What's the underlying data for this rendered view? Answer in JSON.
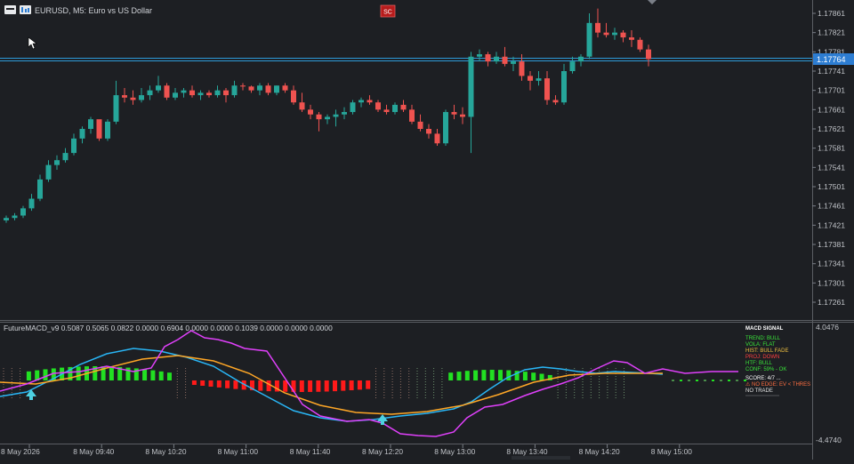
{
  "header": {
    "symbol_title": "EURUSD, M5:  Euro vs US Dollar",
    "mode_badge": "SC"
  },
  "price_axis": {
    "labels": [
      "1.17861",
      "1.17821",
      "1.17781",
      "1.17741",
      "1.17701",
      "1.17661",
      "1.17621",
      "1.17581",
      "1.17541",
      "1.17501",
      "1.17461",
      "1.17421",
      "1.17381",
      "1.17341",
      "1.17301",
      "1.17261"
    ],
    "current_price": "1.17764"
  },
  "indicator": {
    "title": "FutureMACD_v9 0.5087 0.5065 0.0822 0.0000 0.6904 0.0000 0.0000 0.1039 0.0000 0.0000 0.0000",
    "scale_top": "4.0476",
    "scale_bottom": "-4.4740",
    "signal_panel": {
      "title": "MACD SIGNAL",
      "lines": [
        {
          "text": "TREND:  BULL",
          "color": "#39e339"
        },
        {
          "text": "VOLA:  FLAT",
          "color": "#39e339"
        },
        {
          "text": "HIST:  BULL FADE",
          "color": "#f0c040"
        },
        {
          "text": "PROJ:  DOWN",
          "color": "#ff4040"
        },
        {
          "text": "HTF:  BULL",
          "color": "#39e339"
        },
        {
          "text": "CONF:  59% - OK",
          "color": "#39e339"
        }
      ],
      "score": "SCORE: 4/7 ...",
      "warning": "⚠ NO EDGE: EV < THRES",
      "verdict": "NO TRADE"
    }
  },
  "time_axis": {
    "labels": [
      "8 May 2026",
      "8 May 09:40",
      "8 May 10:20",
      "8 May 11:00",
      "8 May 11:40",
      "8 May 12:20",
      "8 May 13:00",
      "8 May 13:40",
      "8 May 14:20",
      "8 May 15:00"
    ]
  },
  "colors": {
    "background": "#1d1f23",
    "bull_candle": "#26a69a",
    "bear_candle": "#ef5350",
    "hist_positive": "#22e022",
    "hist_negative": "#ff1a1a",
    "macd_line": "#29b6f6",
    "signal_line": "#ffa726",
    "projection_line": "#e040fb",
    "price_line": "#2d9cdb"
  },
  "chart_data": {
    "type": "candlestick",
    "x_start": "8 May 2026 09:10",
    "timeframe": "M5",
    "ylim": [
      1.17241,
      1.17891
    ],
    "candles": [
      [
        1.17431,
        1.17441,
        1.17426,
        1.17436
      ],
      [
        1.17436,
        1.17446,
        1.17431,
        1.17441
      ],
      [
        1.17441,
        1.17461,
        1.17436,
        1.17456
      ],
      [
        1.17456,
        1.17486,
        1.17451,
        1.17476
      ],
      [
        1.17476,
        1.17526,
        1.17471,
        1.17516
      ],
      [
        1.17516,
        1.17556,
        1.17511,
        1.17546
      ],
      [
        1.17546,
        1.17566,
        1.17536,
        1.17556
      ],
      [
        1.17556,
        1.17581,
        1.17551,
        1.17571
      ],
      [
        1.17571,
        1.17611,
        1.17566,
        1.17601
      ],
      [
        1.17601,
        1.17626,
        1.17591,
        1.17621
      ],
      [
        1.17621,
        1.17646,
        1.17611,
        1.17641
      ],
      [
        1.17641,
        1.17631,
        1.17596,
        1.17601
      ],
      [
        1.17601,
        1.17641,
        1.17596,
        1.17636
      ],
      [
        1.17636,
        1.17721,
        1.17631,
        1.17691
      ],
      [
        1.17691,
        1.17706,
        1.17676,
        1.17686
      ],
      [
        1.17686,
        1.17701,
        1.17671,
        1.17681
      ],
      [
        1.17681,
        1.17706,
        1.17676,
        1.17691
      ],
      [
        1.17691,
        1.17711,
        1.17681,
        1.17701
      ],
      [
        1.17701,
        1.17731,
        1.17696,
        1.17711
      ],
      [
        1.17711,
        1.17716,
        1.17681,
        1.17686
      ],
      [
        1.17686,
        1.17706,
        1.17681,
        1.17696
      ],
      [
        1.17696,
        1.17706,
        1.17686,
        1.17701
      ],
      [
        1.17701,
        1.17711,
        1.17686,
        1.17691
      ],
      [
        1.17691,
        1.17701,
        1.17681,
        1.17696
      ],
      [
        1.17696,
        1.17701,
        1.17686,
        1.17691
      ],
      [
        1.17691,
        1.17711,
        1.17686,
        1.17701
      ],
      [
        1.17701,
        1.17706,
        1.17676,
        1.17691
      ],
      [
        1.17691,
        1.17721,
        1.17686,
        1.17711
      ],
      [
        1.17711,
        1.17716,
        1.17701,
        1.17709
      ],
      [
        1.17709,
        1.17711,
        1.17696,
        1.17701
      ],
      [
        1.17701,
        1.17716,
        1.17691,
        1.17711
      ],
      [
        1.17711,
        1.17716,
        1.17691,
        1.17696
      ],
      [
        1.17696,
        1.17711,
        1.17691,
        1.17711
      ],
      [
        1.17711,
        1.17716,
        1.17696,
        1.17701
      ],
      [
        1.17701,
        1.17711,
        1.17671,
        1.17676
      ],
      [
        1.17676,
        1.17696,
        1.17656,
        1.17661
      ],
      [
        1.17661,
        1.17671,
        1.17641,
        1.17651
      ],
      [
        1.17651,
        1.17656,
        1.17616,
        1.17641
      ],
      [
        1.17641,
        1.17651,
        1.17631,
        1.17646
      ],
      [
        1.17646,
        1.17661,
        1.17626,
        1.17651
      ],
      [
        1.17651,
        1.17666,
        1.17641,
        1.17656
      ],
      [
        1.17656,
        1.17681,
        1.17651,
        1.17676
      ],
      [
        1.17676,
        1.17686,
        1.17666,
        1.17681
      ],
      [
        1.17681,
        1.17691,
        1.17671,
        1.17676
      ],
      [
        1.17676,
        1.17681,
        1.17656,
        1.17661
      ],
      [
        1.17661,
        1.17671,
        1.17651,
        1.17656
      ],
      [
        1.17656,
        1.17676,
        1.17651,
        1.17671
      ],
      [
        1.17671,
        1.17681,
        1.17656,
        1.17661
      ],
      [
        1.17661,
        1.17671,
        1.17631,
        1.17636
      ],
      [
        1.17636,
        1.17651,
        1.17616,
        1.17621
      ],
      [
        1.17621,
        1.17631,
        1.17601,
        1.17611
      ],
      [
        1.17611,
        1.17621,
        1.17586,
        1.17591
      ],
      [
        1.17591,
        1.17661,
        1.17586,
        1.17656
      ],
      [
        1.17656,
        1.17671,
        1.17641,
        1.17651
      ],
      [
        1.17651,
        1.17666,
        1.17631,
        1.17646
      ],
      [
        1.17646,
        1.17781,
        1.17571,
        1.17771
      ],
      [
        1.17771,
        1.17786,
        1.17761,
        1.17776
      ],
      [
        1.17776,
        1.17781,
        1.17751,
        1.17761
      ],
      [
        1.17761,
        1.17781,
        1.17756,
        1.17771
      ],
      [
        1.17771,
        1.17791,
        1.17751,
        1.17756
      ],
      [
        1.17756,
        1.17771,
        1.17741,
        1.17761
      ],
      [
        1.17761,
        1.17776,
        1.17721,
        1.17731
      ],
      [
        1.17731,
        1.17741,
        1.17701,
        1.17721
      ],
      [
        1.17721,
        1.17741,
        1.17711,
        1.17726
      ],
      [
        1.17726,
        1.17741,
        1.17671,
        1.17681
      ],
      [
        1.17681,
        1.17691,
        1.17671,
        1.17676
      ],
      [
        1.17676,
        1.17756,
        1.17671,
        1.17741
      ],
      [
        1.17741,
        1.17771,
        1.17736,
        1.17761
      ],
      [
        1.17761,
        1.17776,
        1.17751,
        1.17771
      ],
      [
        1.17771,
        1.17861,
        1.17766,
        1.17841
      ],
      [
        1.17841,
        1.17871,
        1.17811,
        1.17821
      ],
      [
        1.17821,
        1.17841,
        1.17811,
        1.17816
      ],
      [
        1.17816,
        1.17831,
        1.17806,
        1.17821
      ],
      [
        1.17821,
        1.17826,
        1.17801,
        1.17811
      ],
      [
        1.17811,
        1.17826,
        1.17791,
        1.17806
      ],
      [
        1.17806,
        1.17811,
        1.17781,
        1.17786
      ],
      [
        1.17786,
        1.17796,
        1.17751,
        1.17766
      ]
    ]
  }
}
